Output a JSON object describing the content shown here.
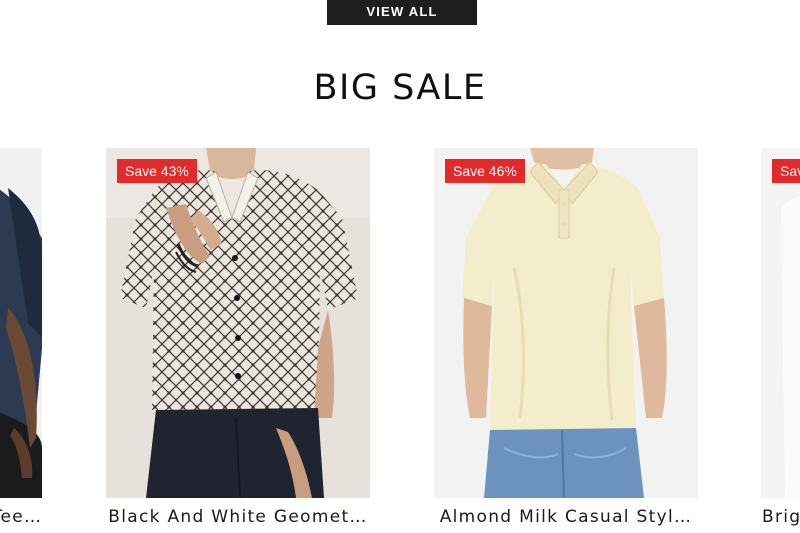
{
  "view_all": {
    "label": "VIEW ALL"
  },
  "section": {
    "title": "BIG SALE"
  },
  "products": [
    {
      "badge": "",
      "title": "Navy Blue Crew Neck Tee …"
    },
    {
      "badge": "Save 43%",
      "title": "Black And White Geomet…"
    },
    {
      "badge": "Save 46%",
      "title": "Almond Milk Casual Styl…"
    },
    {
      "badge": "Save",
      "title": "Brig"
    }
  ],
  "colors": {
    "badge_bg": "#e32a2a",
    "button_bg": "#1e1e1e",
    "text": "#111111"
  }
}
